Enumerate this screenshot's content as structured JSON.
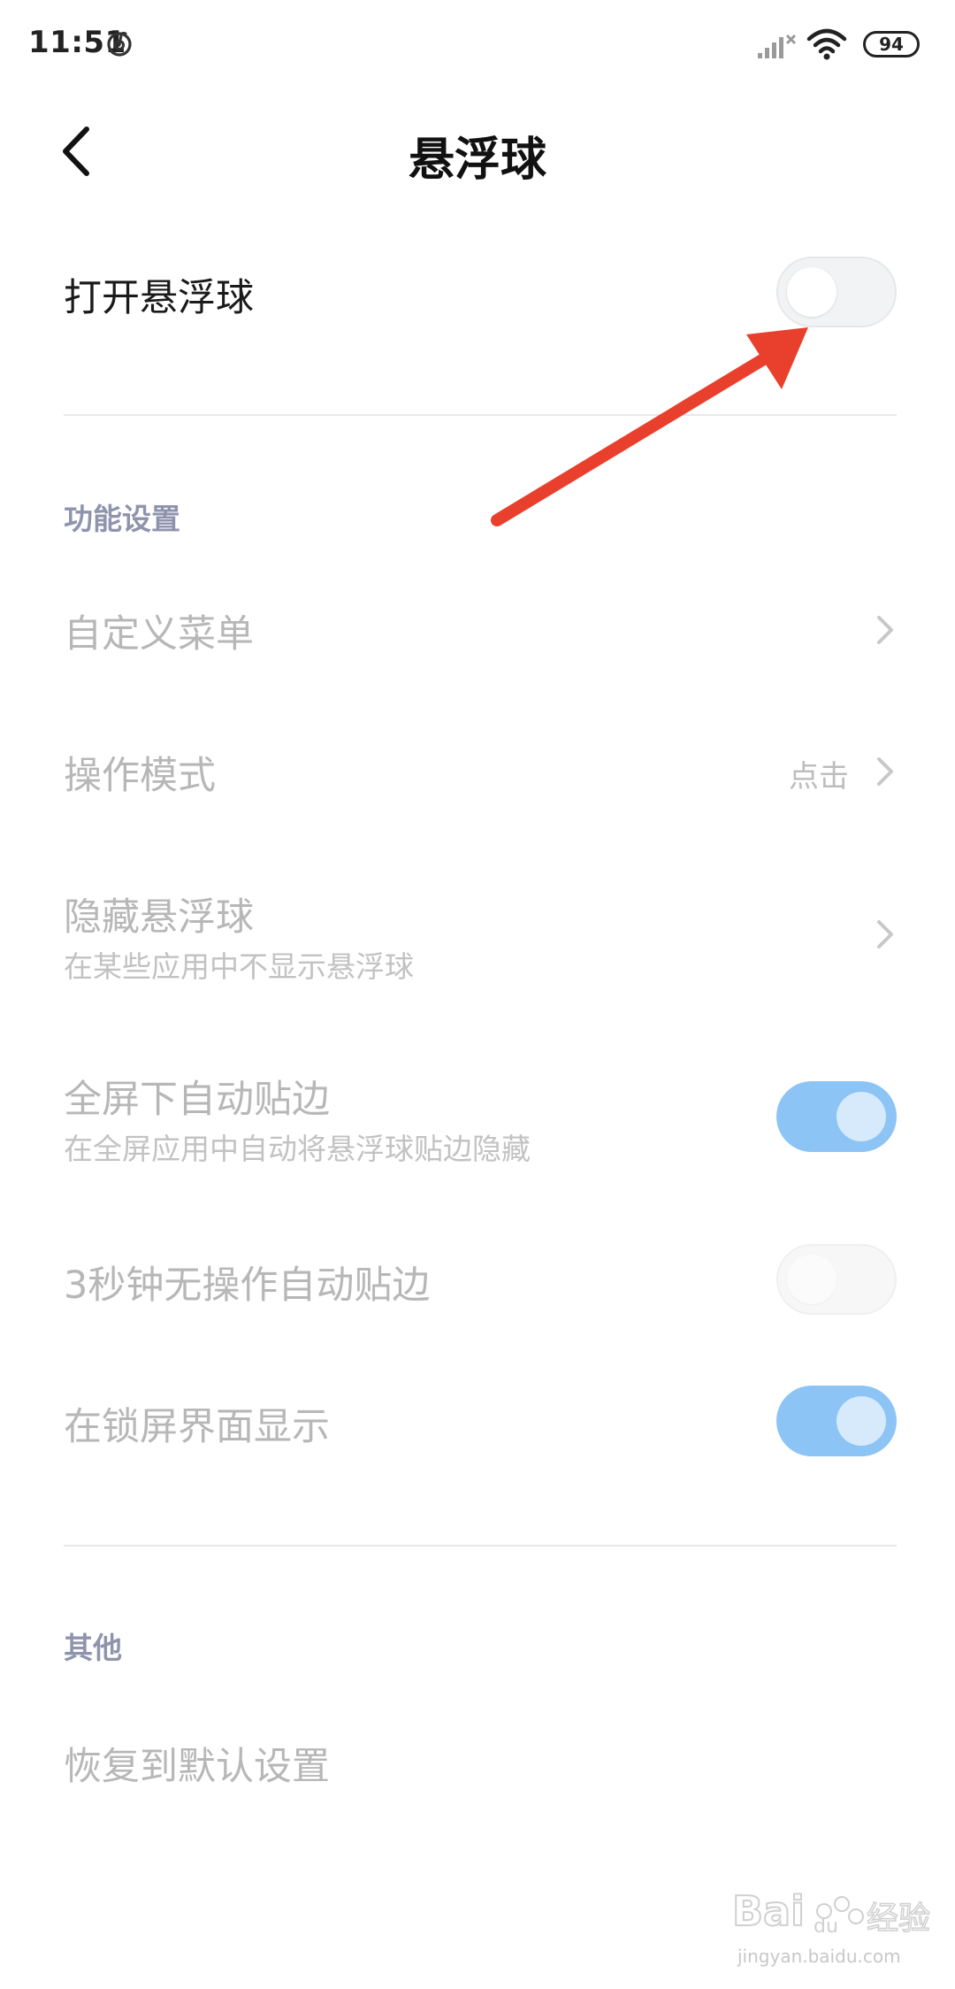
{
  "status_bar": {
    "time": "11:51",
    "battery": "94",
    "icons": [
      "netease-music-icon",
      "signal-off-icon",
      "wifi-icon",
      "battery-icon"
    ]
  },
  "header": {
    "title": "悬浮球",
    "back_icon": "back-arrow-icon"
  },
  "main_toggle": {
    "label": "打开悬浮球",
    "enabled": false
  },
  "sections": {
    "function": {
      "header": "功能设置",
      "items": [
        {
          "title": "自定义菜单"
        },
        {
          "title": "操作模式",
          "value": "点击"
        },
        {
          "title": "隐藏悬浮球",
          "subtitle": "在某些应用中不显示悬浮球"
        },
        {
          "title": "全屏下自动贴边",
          "subtitle": "在全屏应用中自动将悬浮球贴边隐藏",
          "toggle": true
        },
        {
          "title": "3秒钟无操作自动贴边",
          "toggle": false
        },
        {
          "title": "在锁屏界面显示",
          "toggle": true
        }
      ]
    },
    "other": {
      "header": "其他",
      "items": [
        {
          "title": "恢复到默认设置"
        }
      ]
    }
  },
  "colors": {
    "accent_toggle_on": "#8cc4f5",
    "section_header": "#8f94ad",
    "annotation_arrow": "#e8402c"
  },
  "watermark": {
    "brand": "Baidu经验",
    "url": "jingyan.baidu.com"
  }
}
